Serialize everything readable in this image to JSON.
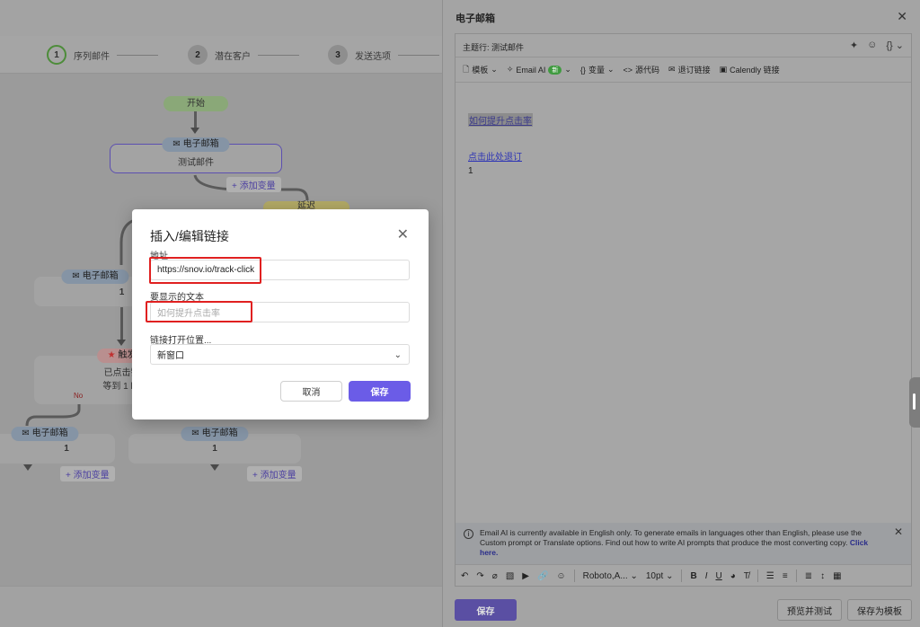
{
  "stepper": {
    "steps": [
      {
        "num": "1",
        "label": "序列邮件"
      },
      {
        "num": "2",
        "label": "潜在客户"
      },
      {
        "num": "3",
        "label": "发送选项"
      }
    ]
  },
  "flow": {
    "start_label": "开始",
    "email_tag": "电子邮箱",
    "email1_name": "测试邮件",
    "add_variable": "+ 添加变量",
    "condition_tag": "延迟",
    "branch_left_count": "1",
    "trigger_tag": "触发",
    "trigger_line1": "已点击链",
    "trigger_line2": "等到 1 ho",
    "no_label": "No",
    "bottom_left_count": "1",
    "bottom_mid_count": "1"
  },
  "modal": {
    "title": "插入/编辑链接",
    "url_label": "地址",
    "url_value": "https://snov.io/track-click",
    "text_label": "要显示的文本",
    "text_placeholder": "如何提升点击率",
    "target_label": "链接打开位置...",
    "target_value": "新窗口",
    "cancel": "取消",
    "save": "保存"
  },
  "panel": {
    "title": "电子邮箱",
    "subject": "主题行: 测试邮件",
    "toolbar": {
      "template": "模板",
      "email_ai": "Email AI",
      "email_ai_badge": "新",
      "variables": "变量",
      "source": "源代码",
      "unsubscribe": "退订链接",
      "calendly": "Calendly 链接"
    },
    "body": {
      "link1": "如何提升点击率",
      "link2": "点击此处退订",
      "num": "1"
    },
    "info": {
      "text": "Email AI is currently available in English only. To generate emails in languages other than English, please use the Custom prompt or Translate options. Find out how to write AI prompts that produce the most converting copy.",
      "click_here": "Click here."
    },
    "format": {
      "font": "Roboto,A...",
      "size": "10pt"
    },
    "save": "保存",
    "preview": "预览并测试",
    "save_template": "保存为模板"
  }
}
